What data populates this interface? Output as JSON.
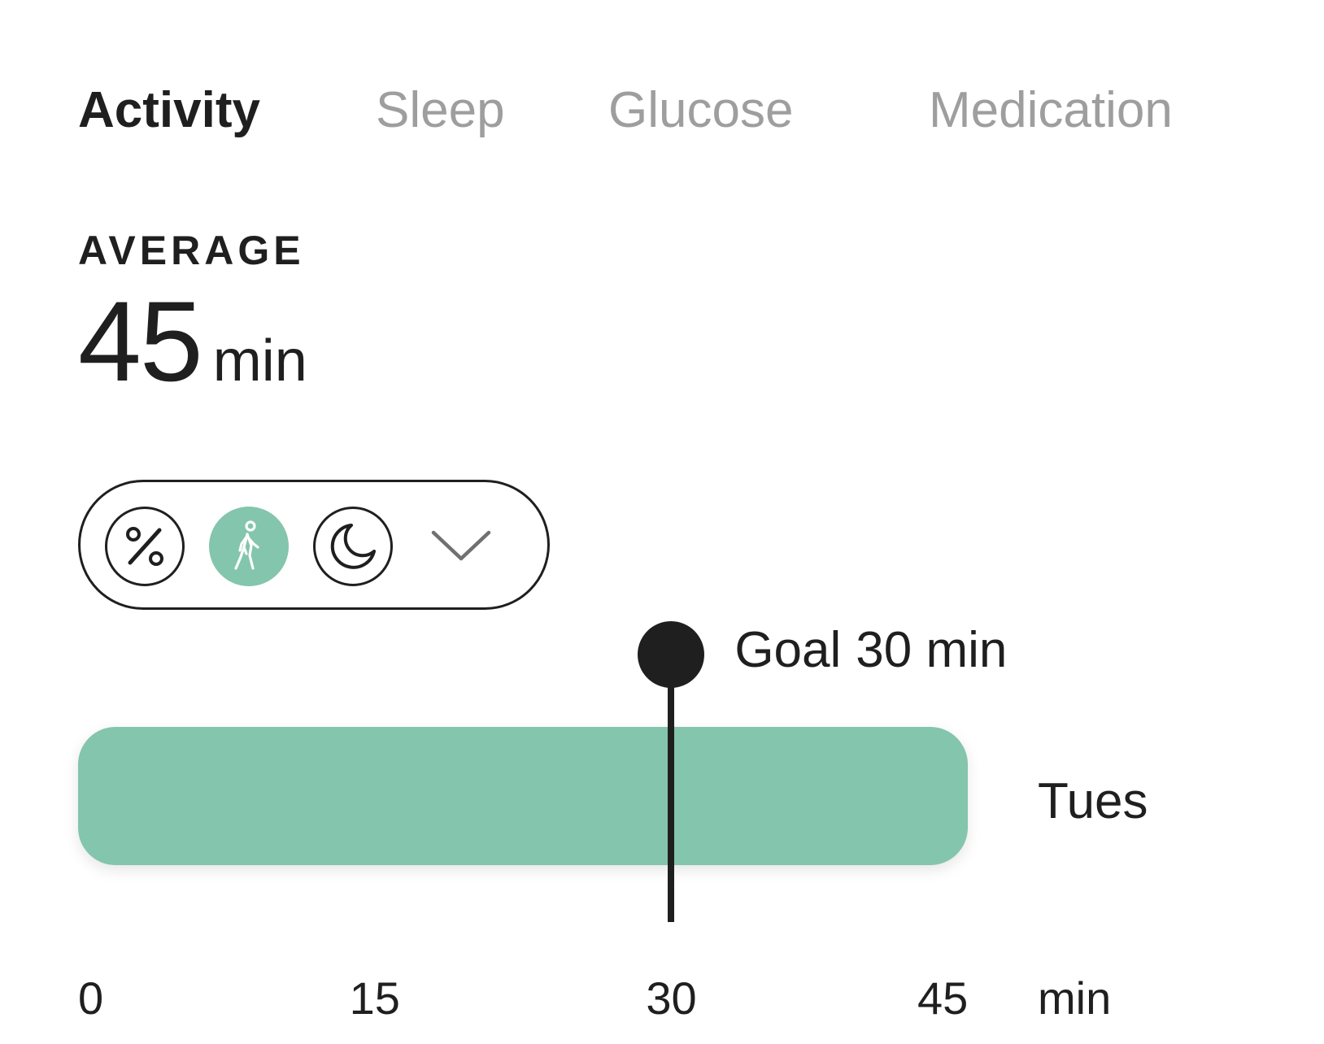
{
  "tabs": [
    {
      "label": "Activity",
      "active": true
    },
    {
      "label": "Sleep",
      "active": false
    },
    {
      "label": "Glucose",
      "active": false
    },
    {
      "label": "Medication",
      "active": false
    }
  ],
  "summary": {
    "label": "AVERAGE",
    "value": "45",
    "unit": "min"
  },
  "toggles": [
    {
      "icon": "percent-icon",
      "selected": false
    },
    {
      "icon": "walking-icon",
      "selected": true
    },
    {
      "icon": "moon-icon",
      "selected": false
    },
    {
      "icon": "chevron-down-icon",
      "selected": false
    }
  ],
  "colors": {
    "accent": "#84c5ad",
    "text": "#1f1f1f",
    "inactive_tab": "#9e9e9e"
  },
  "chart_data": {
    "type": "bar",
    "orientation": "horizontal",
    "categories": [
      "Tues"
    ],
    "values": [
      45
    ],
    "goal": {
      "label_prefix": "Goal",
      "value": 30,
      "label_value": "30 min"
    },
    "xticks": [
      "0",
      "15",
      "30",
      "45"
    ],
    "xtick_values": [
      0,
      15,
      30,
      45
    ],
    "xunit": "min",
    "xlim": [
      0,
      45
    ],
    "grid": false
  }
}
